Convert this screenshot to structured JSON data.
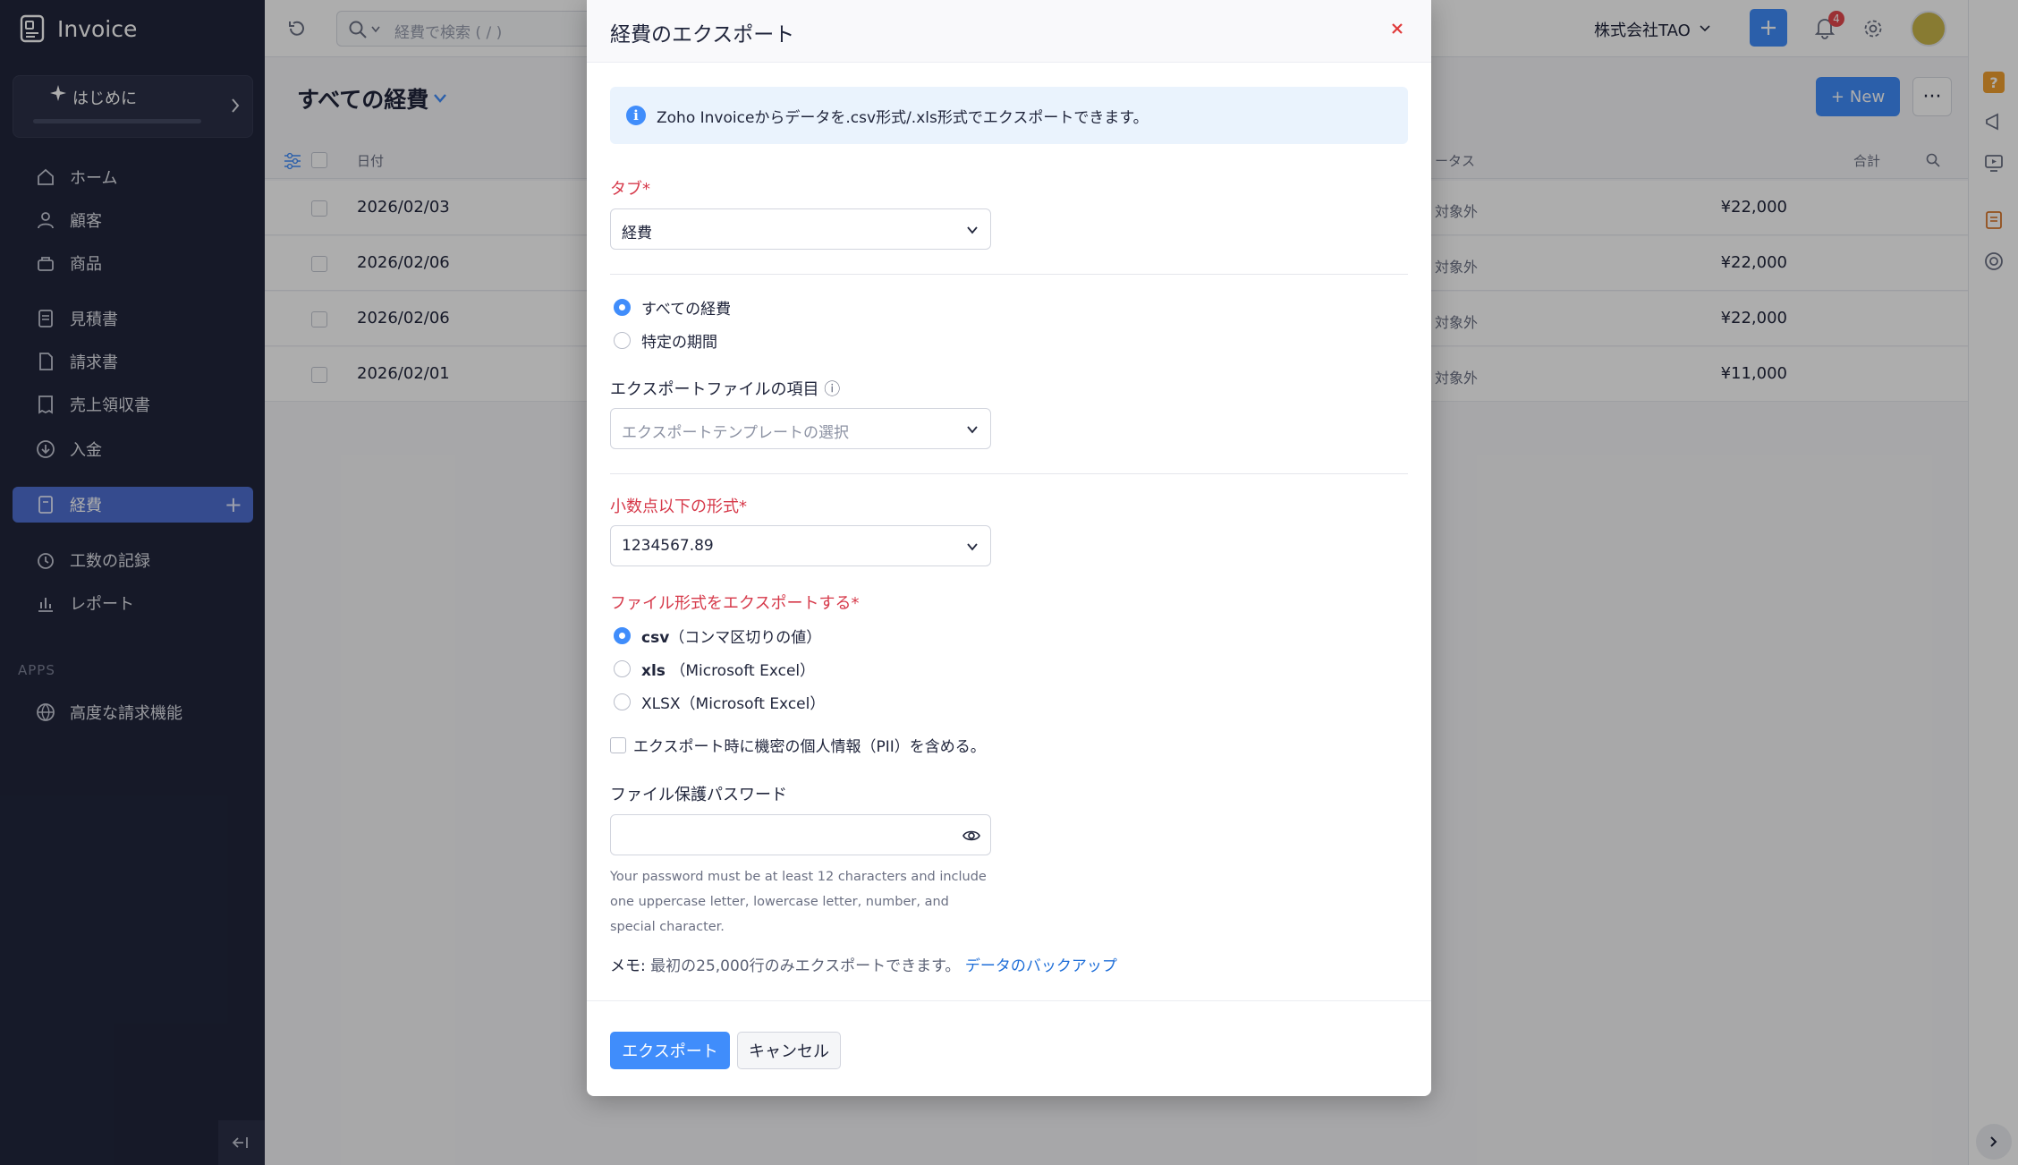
{
  "app": {
    "name": "Invoice"
  },
  "sidebar": {
    "getting_started": "はじめに",
    "items": [
      {
        "label": "ホーム",
        "icon": "home-icon"
      },
      {
        "label": "顧客",
        "icon": "user-icon"
      },
      {
        "label": "商品",
        "icon": "basket-icon"
      },
      {
        "label": "見積書",
        "icon": "document-icon"
      },
      {
        "label": "請求書",
        "icon": "invoice-icon"
      },
      {
        "label": "売上領収書",
        "icon": "receipt-icon"
      },
      {
        "label": "入金",
        "icon": "download-icon"
      },
      {
        "label": "経費",
        "icon": "expense-icon",
        "active": true
      },
      {
        "label": "工数の記録",
        "icon": "clock-icon"
      },
      {
        "label": "レポート",
        "icon": "chart-icon"
      }
    ],
    "apps_heading": "APPS",
    "apps": [
      {
        "label": "高度な請求機能",
        "icon": "globe-icon"
      }
    ]
  },
  "topbar": {
    "search_placeholder": "経費で検索 ( / )",
    "org_name": "株式会社TAO",
    "notification_count": "4"
  },
  "list": {
    "title": "すべての経費",
    "new_label": "New",
    "more_label": "···",
    "headers": {
      "date": "日付",
      "status": "ータス",
      "total": "合計"
    },
    "rows": [
      {
        "date": "2026/02/03",
        "status": "対象外",
        "amount": "¥22,000"
      },
      {
        "date": "2026/02/06",
        "status": "対象外",
        "amount": "¥22,000"
      },
      {
        "date": "2026/02/06",
        "status": "対象外",
        "amount": "¥22,000"
      },
      {
        "date": "2026/02/01",
        "status": "対象外",
        "amount": "¥11,000"
      }
    ]
  },
  "modal": {
    "title": "経費のエクスポート",
    "info": "Zoho Invoiceからデータを.csv形式/.xls形式でエクスポートできます。",
    "tab_label": "タブ*",
    "tab_value": "経費",
    "range_options": [
      "すべての経費",
      "特定の期間"
    ],
    "template_label": "エクスポートファイルの項目",
    "template_info_icon": "ⓘ",
    "template_placeholder": "エクスポートテンプレートの選択",
    "decimal_label": "小数点以下の形式*",
    "decimal_value": "1234567.89",
    "format_label": "ファイル形式をエクスポートする*",
    "format_options": [
      {
        "bold": "csv",
        "rest": "（コンマ区切りの値）"
      },
      {
        "bold": "xls",
        "rest": " （Microsoft Excel）"
      },
      {
        "bold": "",
        "rest": "XLSX（Microsoft Excel）"
      }
    ],
    "pii_label": "エクスポート時に機密の個人情報（PII）を含める。",
    "password_label": "ファイル保護パスワード",
    "password_help": "Your password must be at least 12 characters and include one uppercase letter, lowercase letter, number, and special character.",
    "note_prefix": "メモ: ",
    "note_text": "最初の25,000行のみエクスポートできます。",
    "note_link": "データのバックアップ",
    "export_button": "エクスポート",
    "cancel_button": "キャンセル"
  },
  "colors": {
    "primary": "#408dfb",
    "sidebar": "#21263c",
    "required": "#d6394a",
    "close": "#e03a3a"
  }
}
